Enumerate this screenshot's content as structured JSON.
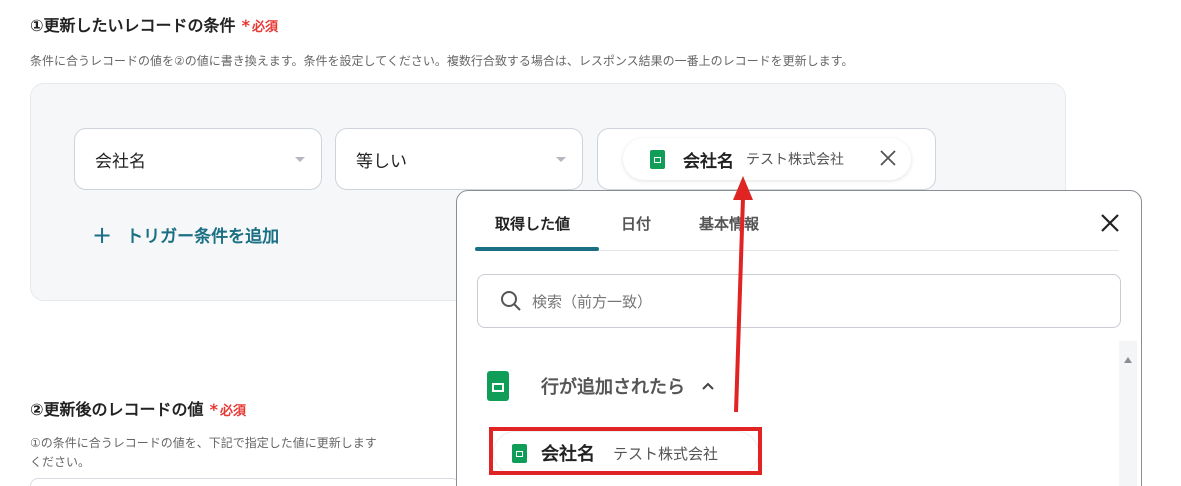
{
  "section1": {
    "title": "①更新したいレコードの条件",
    "required_star": "*",
    "required_label": "必須",
    "description": "条件に合うレコードの値を②の値に書き換えます。条件を設定してください。複数行合致する場合は、レスポンス結果の一番上のレコードを更新します。"
  },
  "condition": {
    "field_select": "会社名",
    "operator_select": "等しい",
    "value_chip": {
      "name": "会社名",
      "value": "テスト株式会社",
      "icon": "spreadsheet-icon"
    },
    "add_trigger_plus": "+",
    "add_trigger_label": "トリガー条件を追加"
  },
  "section2": {
    "title": "②更新後のレコードの値",
    "required_star": "*",
    "required_label": "必須",
    "description_line1": "①の条件に合うレコードの値を、下記で指定した値に更新します",
    "description_line2": "ください。"
  },
  "dropdown": {
    "tabs": [
      "取得した値",
      "日付",
      "基本情報"
    ],
    "active_tab": "取得した値",
    "search_placeholder": "検索（前方一致）",
    "group_label": "行が追加されたら",
    "option": {
      "name": "会社名",
      "value": "テスト株式会社"
    }
  },
  "colors": {
    "accent": "#1a6f84",
    "required": "#e53935",
    "annotation": "#e02424",
    "sheets_green": "#0f9d58"
  }
}
